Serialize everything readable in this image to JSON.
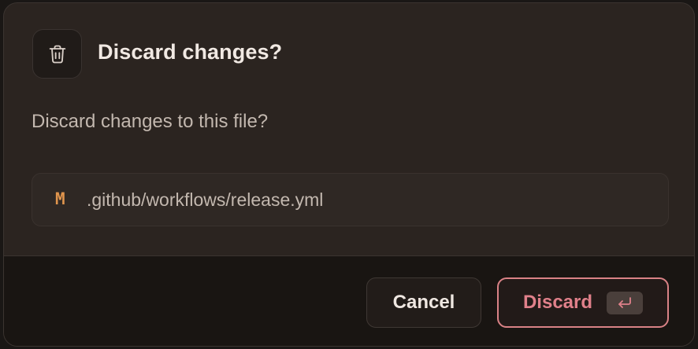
{
  "dialog": {
    "title": "Discard changes?",
    "message": "Discard changes to this file?",
    "header_icon": "trash-icon",
    "file": {
      "status": "M",
      "path": ".github/workflows/release.yml",
      "status_color": "#e0954d"
    },
    "buttons": {
      "cancel_label": "Cancel",
      "discard_label": "Discard",
      "discard_shortcut_icon": "enter-key-icon"
    },
    "colors": {
      "danger": "#e0808a",
      "background": "#2b2420",
      "footer": "#191512"
    }
  }
}
